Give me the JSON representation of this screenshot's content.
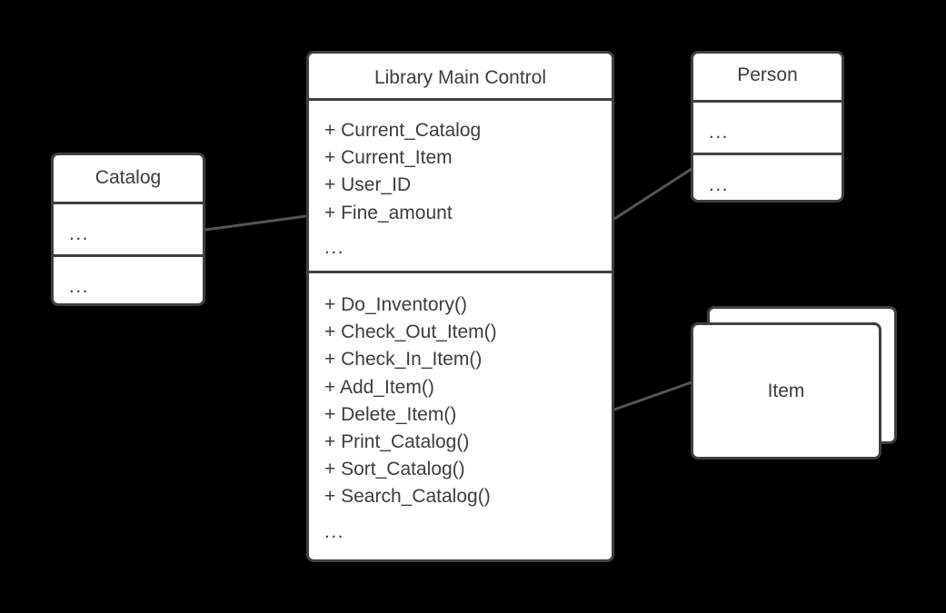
{
  "diagram": {
    "type": "uml-class-diagram",
    "background_color": "#000000",
    "box_fill": "#ffffff",
    "stroke_color": "#404040",
    "text_color": "#3d3d3d",
    "ellipsis": "..."
  },
  "classes": {
    "main_control": {
      "name": "Library Main Control",
      "attributes": [
        "+ Current_Catalog",
        "+ Current_Item",
        "+ User_ID",
        "+ Fine_amount",
        "..."
      ],
      "methods": [
        "+ Do_Inventory()",
        "+ Check_Out_Item()",
        "+ Check_In_Item()",
        "+ Add_Item()",
        "+ Delete_Item()",
        "+ Print_Catalog()",
        "+ Sort_Catalog()",
        "+ Search_Catalog()",
        "..."
      ]
    },
    "catalog": {
      "name": "Catalog",
      "attributes_placeholder": "...",
      "methods_placeholder": "..."
    },
    "person": {
      "name": "Person",
      "attributes_placeholder": "...",
      "methods_placeholder": "..."
    },
    "item": {
      "name": "Item",
      "stacked": "true"
    }
  },
  "associations": [
    {
      "from": "Catalog",
      "to": "Library Main Control"
    },
    {
      "from": "Library Main Control",
      "to": "Person"
    },
    {
      "from": "Library Main Control",
      "to": "Item"
    }
  ]
}
